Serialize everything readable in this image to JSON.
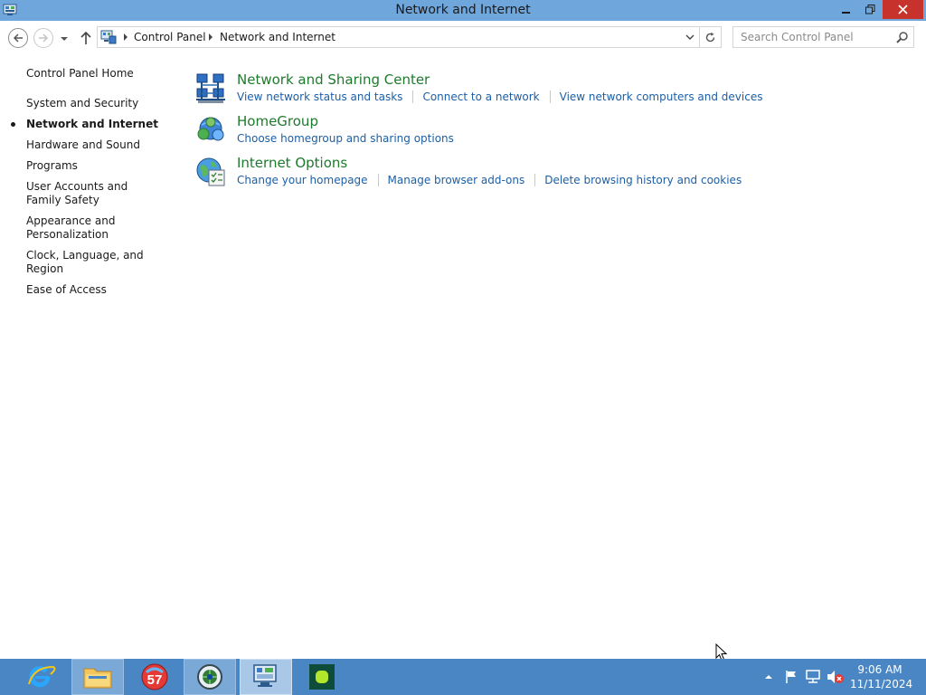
{
  "window": {
    "title": "Network and Internet"
  },
  "address_bar": {
    "breadcrumbs": [
      "Control Panel",
      "Network and Internet"
    ],
    "search_placeholder": "Search Control Panel"
  },
  "left_nav": {
    "home_label": "Control Panel Home",
    "items": [
      {
        "label": "System and Security",
        "active": false
      },
      {
        "label": "Network and Internet",
        "active": true
      },
      {
        "label": "Hardware and Sound",
        "active": false
      },
      {
        "label": "Programs",
        "active": false
      },
      {
        "label": "User Accounts and Family Safety",
        "active": false
      },
      {
        "label": "Appearance and Personalization",
        "active": false
      },
      {
        "label": "Clock, Language, and Region",
        "active": false
      },
      {
        "label": "Ease of Access",
        "active": false
      }
    ]
  },
  "categories": [
    {
      "title": "Network and Sharing Center",
      "icon": "network-sharing-icon",
      "links": [
        "View network status and tasks",
        "Connect to a network",
        "View network computers and devices"
      ]
    },
    {
      "title": "HomeGroup",
      "icon": "homegroup-icon",
      "links": [
        "Choose homegroup and sharing options"
      ]
    },
    {
      "title": "Internet Options",
      "icon": "internet-options-icon",
      "links": [
        "Change your homepage",
        "Manage browser add-ons",
        "Delete browsing history and cookies"
      ]
    }
  ],
  "taskbar": {
    "apps": [
      {
        "name": "internet-explorer",
        "open": false
      },
      {
        "name": "file-explorer",
        "open": true
      },
      {
        "name": "badge-57-app",
        "badge": "57",
        "open": false
      },
      {
        "name": "globe-app",
        "open": true
      },
      {
        "name": "control-panel",
        "open": true,
        "active": true
      },
      {
        "name": "green-app",
        "open": false
      }
    ],
    "clock": {
      "time": "9:06 AM",
      "date": "11/11/2024"
    }
  },
  "colors": {
    "title_bar": "#6fa6dc",
    "close_button": "#c7332c",
    "category_title": "#1e7a2c",
    "link": "#1c5fa6",
    "taskbar": "#4a86c3"
  }
}
